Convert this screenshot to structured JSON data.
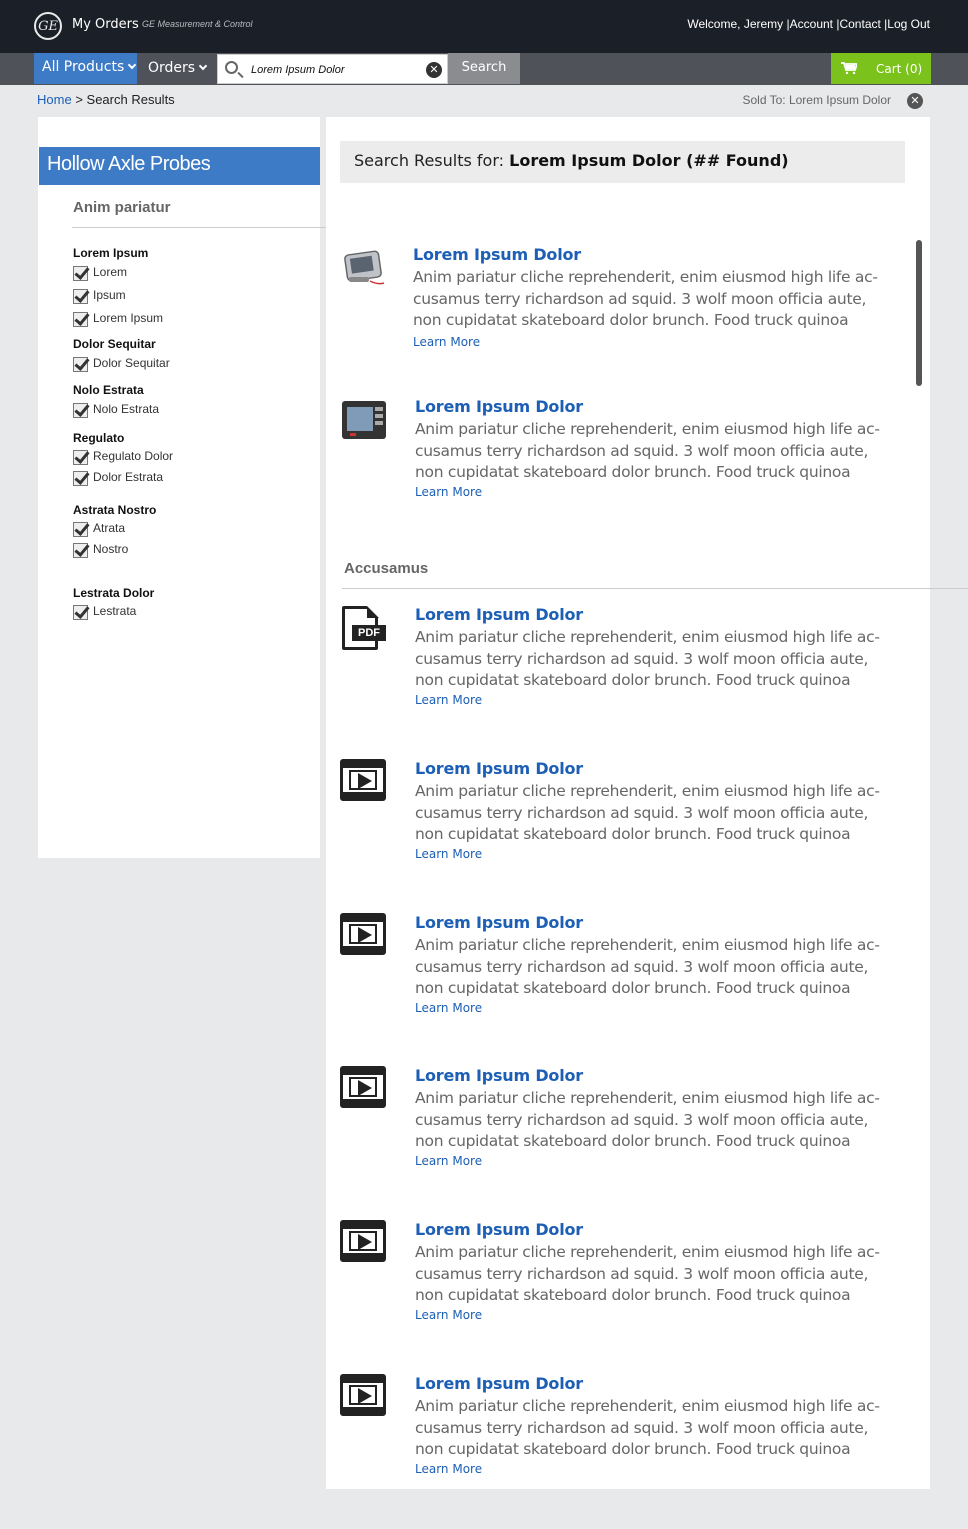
{
  "header": {
    "logo_text": "GE",
    "app_title": "My Orders",
    "app_subtitle": "GE Measurement & Control",
    "welcome": "Welcome, Jeremy",
    "links": [
      "Account",
      "Contact",
      "Log Out"
    ],
    "separator": "|"
  },
  "nav": {
    "all_products": "All Products",
    "orders": "Orders",
    "search_value": "Lorem Ipsum Dolor",
    "search_button": "Search",
    "cart": "Cart (0)"
  },
  "breadcrumb": {
    "home": "Home",
    "sep": ">",
    "current": "Search Results",
    "sold_to": "Sold To: Lorem Ipsum Dolor"
  },
  "sidebar": {
    "title": "Hollow Axle Probes",
    "filter_heading": "Anim pariatur",
    "groups": [
      {
        "title": "Lorem Ipsum",
        "items": [
          "Lorem",
          "Ipsum",
          "Lorem Ipsum"
        ]
      },
      {
        "title": "Dolor Sequitar",
        "items": [
          "Dolor Sequitar"
        ]
      },
      {
        "title": "Nolo Estrata",
        "items": [
          "Nolo Estrata"
        ]
      },
      {
        "title": "Regulato",
        "items": [
          "Regulato Dolor",
          "Dolor Estrata"
        ]
      },
      {
        "title": "Astrata Nostro",
        "items": [
          "Atrata",
          "Nostro"
        ]
      },
      {
        "title": "Lestrata Dolor",
        "items": [
          "Lestrata"
        ]
      }
    ]
  },
  "results": {
    "header_prefix": "Search Results for:",
    "header_query": "Lorem Ipsum Dolor (## Found)",
    "section_heading": "Accusamus",
    "learn_more": "Learn More",
    "items": [
      {
        "title": "Lorem Ipsum Dolor",
        "icon": "device-photo",
        "desc": "Anim pariatur cliche reprehenderit, enim eiusmod high life ac-cusamus terry richardson ad squid. 3 wolf moon officia aute, non cupidatat skateboard dolor brunch. Food truck quinoa"
      },
      {
        "title": "Lorem Ipsum Dolor",
        "icon": "device-photo",
        "desc": "Anim pariatur cliche reprehenderit, enim eiusmod high life ac-cusamus terry richardson ad squid. 3 wolf moon officia aute, non cupidatat skateboard dolor brunch. Food truck quinoa"
      },
      {
        "title": "Lorem Ipsum Dolor",
        "icon": "pdf-icon",
        "icon_text": "PDF",
        "desc": "Anim pariatur cliche reprehenderit, enim eiusmod high life ac-cusamus terry richardson ad squid. 3 wolf moon officia aute, non cupidatat skateboard dolor brunch. Food truck quinoa"
      },
      {
        "title": "Lorem Ipsum Dolor",
        "icon": "video-icon",
        "desc": "Anim pariatur cliche reprehenderit, enim eiusmod high life ac-cusamus terry richardson ad squid. 3 wolf moon officia aute, non cupidatat skateboard dolor brunch. Food truck quinoa"
      },
      {
        "title": "Lorem Ipsum Dolor",
        "icon": "video-icon",
        "desc": "Anim pariatur cliche reprehenderit, enim eiusmod high life ac-cusamus terry richardson ad squid. 3 wolf moon officia aute, non cupidatat skateboard dolor brunch. Food truck quinoa"
      },
      {
        "title": "Lorem Ipsum Dolor",
        "icon": "video-icon",
        "desc": "Anim pariatur cliche reprehenderit, enim eiusmod high life ac-cusamus terry richardson ad squid. 3 wolf moon officia aute, non cupidatat skateboard dolor brunch. Food truck quinoa"
      },
      {
        "title": "Lorem Ipsum Dolor",
        "icon": "video-icon",
        "desc": "Anim pariatur cliche reprehenderit, enim eiusmod high life ac-cusamus terry richardson ad squid. 3 wolf moon officia aute, non cupidatat skateboard dolor brunch. Food truck quinoa"
      },
      {
        "title": "Lorem Ipsum Dolor",
        "icon": "video-icon",
        "desc": "Anim pariatur cliche reprehenderit, enim eiusmod high life ac-cusamus terry richardson ad squid. 3 wolf moon officia aute, non cupidatat skateboard dolor brunch. Food truck quinoa"
      }
    ]
  },
  "colors": {
    "header_bg": "#1b1f27",
    "nav_bg": "#4f5259",
    "accent_blue": "#3e7bc6",
    "link_blue": "#1d5fb5",
    "cart_green": "#7cc21d"
  }
}
